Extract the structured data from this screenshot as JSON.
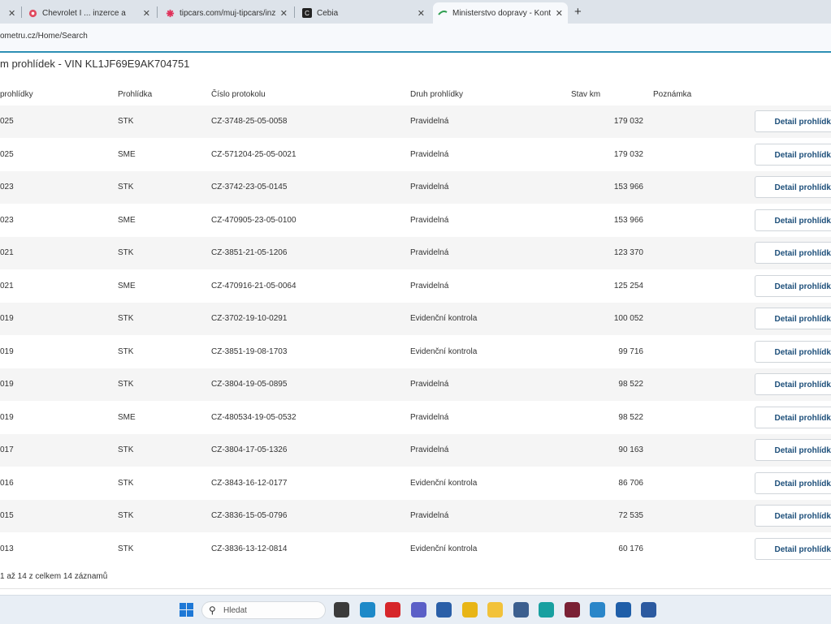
{
  "browser": {
    "tabs": [
      {
        "title": "Chevrolet I ... inzerce a",
        "icon": "flower-icon",
        "color": "#e04a5f"
      },
      {
        "title": "tipcars.com/muj-tipcars/inzerce",
        "icon": "flower-icon",
        "color": "#e0315a"
      },
      {
        "title": "Cebia",
        "icon": "cebia-logo-icon",
        "color": "#222222"
      },
      {
        "title": "Ministerstvo dopravy - Kontrola",
        "icon": "ministry-logo-icon",
        "color": "#2e9e4f"
      }
    ],
    "close_glyph": "✕",
    "new_tab_glyph": "+",
    "address": "ometru.cz/Home/Search"
  },
  "page": {
    "title": "m prohlídek - VIN KL1JF69E9AK704751",
    "columns": {
      "date": "prohlídky",
      "type": "Prohlídka",
      "protocol": "Číslo protokolu",
      "kind": "Druh prohlídky",
      "km": "Stav km",
      "note": "Poznámka"
    },
    "detail_label": "Detail prohlídky",
    "rows": [
      {
        "date": "025",
        "type": "STK",
        "protocol": "CZ-3748-25-05-0058",
        "kind": "Pravidelná",
        "km": "179 032",
        "note": ""
      },
      {
        "date": "025",
        "type": "SME",
        "protocol": "CZ-571204-25-05-0021",
        "kind": "Pravidelná",
        "km": "179 032",
        "note": ""
      },
      {
        "date": "023",
        "type": "STK",
        "protocol": "CZ-3742-23-05-0145",
        "kind": "Pravidelná",
        "km": "153 966",
        "note": ""
      },
      {
        "date": "023",
        "type": "SME",
        "protocol": "CZ-470905-23-05-0100",
        "kind": "Pravidelná",
        "km": "153 966",
        "note": ""
      },
      {
        "date": "021",
        "type": "STK",
        "protocol": "CZ-3851-21-05-1206",
        "kind": "Pravidelná",
        "km": "123 370",
        "note": ""
      },
      {
        "date": "021",
        "type": "SME",
        "protocol": "CZ-470916-21-05-0064",
        "kind": "Pravidelná",
        "km": "125 254",
        "note": ""
      },
      {
        "date": "019",
        "type": "STK",
        "protocol": "CZ-3702-19-10-0291",
        "kind": "Evidenční kontrola",
        "km": "100 052",
        "note": ""
      },
      {
        "date": "019",
        "type": "STK",
        "protocol": "CZ-3851-19-08-1703",
        "kind": "Evidenční kontrola",
        "km": "99 716",
        "note": ""
      },
      {
        "date": "019",
        "type": "STK",
        "protocol": "CZ-3804-19-05-0895",
        "kind": "Pravidelná",
        "km": "98 522",
        "note": ""
      },
      {
        "date": "019",
        "type": "SME",
        "protocol": "CZ-480534-19-05-0532",
        "kind": "Pravidelná",
        "km": "98 522",
        "note": ""
      },
      {
        "date": "017",
        "type": "STK",
        "protocol": "CZ-3804-17-05-1326",
        "kind": "Pravidelná",
        "km": "90 163",
        "note": ""
      },
      {
        "date": "016",
        "type": "STK",
        "protocol": "CZ-3843-16-12-0177",
        "kind": "Evidenční kontrola",
        "km": "86 706",
        "note": ""
      },
      {
        "date": "015",
        "type": "STK",
        "protocol": "CZ-3836-15-05-0796",
        "kind": "Pravidelná",
        "km": "72 535",
        "note": ""
      },
      {
        "date": "013",
        "type": "STK",
        "protocol": "CZ-3836-13-12-0814",
        "kind": "Evidenční kontrola",
        "km": "60 176",
        "note": ""
      }
    ],
    "footer": "1 až 14 z celkem 14 záznamů"
  },
  "taskbar": {
    "search_placeholder": "Hledat",
    "search_icon": "magnifier-icon",
    "apps": [
      {
        "name": "file-icon",
        "color": "#3b3b3b"
      },
      {
        "name": "edge-app-icon",
        "color": "#1d89c8"
      },
      {
        "name": "red-app-icon",
        "color": "#d6262a"
      },
      {
        "name": "teams-icon",
        "color": "#5b5fc7"
      },
      {
        "name": "store-icon",
        "color": "#2a5fa8"
      },
      {
        "name": "chrome-icon",
        "color": "#e8b516"
      },
      {
        "name": "folder-icon",
        "color": "#f2c23a"
      },
      {
        "name": "network-icon",
        "color": "#3c5f8f"
      },
      {
        "name": "browser-icon",
        "color": "#18a0a0"
      },
      {
        "name": "game-icon",
        "color": "#7a2135"
      },
      {
        "name": "chat-icon",
        "color": "#2a86c9"
      },
      {
        "name": "users-icon",
        "color": "#1f5ea8"
      },
      {
        "name": "tool-icon",
        "color": "#2c5aa0"
      }
    ]
  }
}
